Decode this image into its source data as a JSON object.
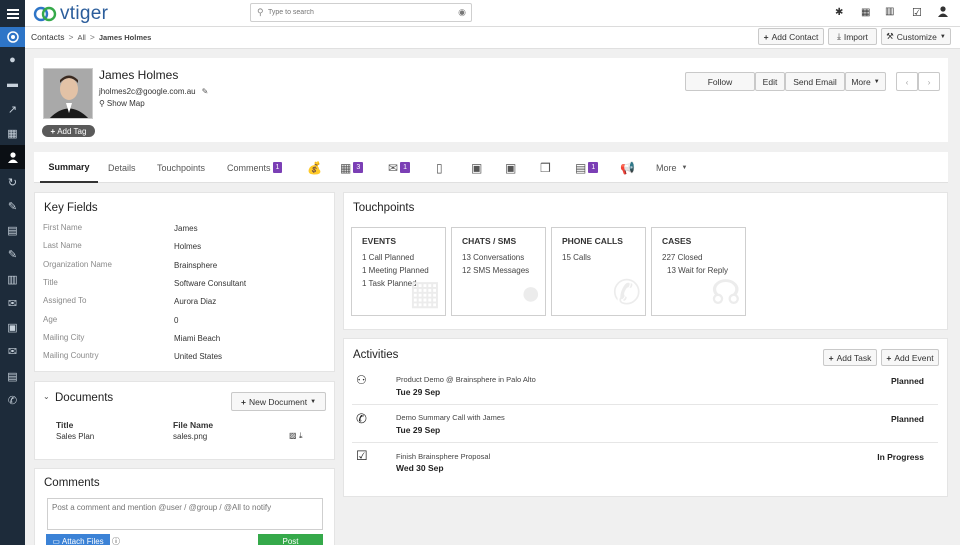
{
  "app": {
    "name": "vtiger"
  },
  "search": {
    "placeholder": "Type to search"
  },
  "breadcrumb": {
    "module": "Contacts",
    "filter": "All",
    "record": "James Holmes"
  },
  "header_actions": {
    "add": "Add Contact",
    "import": "Import",
    "customize": "Customize"
  },
  "contact": {
    "name": "James Holmes",
    "email": "jholmes2c@google.com.au",
    "show_map": "Show Map",
    "add_tag": "Add Tag"
  },
  "record_actions": {
    "follow": "Follow",
    "edit": "Edit",
    "send_email": "Send Email",
    "more": "More"
  },
  "tabs": [
    {
      "label": "Summary"
    },
    {
      "label": "Details"
    },
    {
      "label": "Touchpoints"
    },
    {
      "label": "Comments",
      "badge": "1"
    }
  ],
  "icon_tabs": [
    {
      "icon": "money-bag-icon",
      "badge": ""
    },
    {
      "icon": "calendar-icon",
      "badge": "3"
    },
    {
      "icon": "email-icon",
      "badge": "1"
    },
    {
      "icon": "contact-card-icon",
      "badge": ""
    },
    {
      "icon": "quote-icon",
      "badge": ""
    },
    {
      "icon": "sales-order-icon",
      "badge": ""
    },
    {
      "icon": "product-box-icon",
      "badge": ""
    },
    {
      "icon": "document-icon",
      "badge": "1"
    },
    {
      "icon": "campaign-megaphone-icon",
      "badge": ""
    }
  ],
  "tabs_more": "More",
  "key_fields": {
    "title": "Key Fields",
    "rows": [
      {
        "label": "First Name",
        "value": "James"
      },
      {
        "label": "Last Name",
        "value": "Holmes"
      },
      {
        "label": "Organization Name",
        "value": "Brainsphere"
      },
      {
        "label": "Title",
        "value": "Software Consultant"
      },
      {
        "label": "Assigned To",
        "value": "Aurora Diaz"
      },
      {
        "label": "Age",
        "value": "0"
      },
      {
        "label": "Mailing City",
        "value": "Miami Beach"
      },
      {
        "label": "Mailing Country",
        "value": "United States"
      }
    ]
  },
  "documents": {
    "title": "Documents",
    "new_button": "New Document",
    "col_title": "Title",
    "col_file": "File Name",
    "row": {
      "title": "Sales Plan",
      "file": "sales.png"
    }
  },
  "comments": {
    "title": "Comments",
    "placeholder": "Post a comment and mention @user / @group / @All to notify",
    "attach": "Attach Files",
    "post": "Post"
  },
  "touchpoints": {
    "title": "Touchpoints",
    "boxes": [
      {
        "title": "EVENTS",
        "lines": [
          "1 Call Planned",
          "1 Meeting Planned",
          "1 Task Planned"
        ]
      },
      {
        "title": "CHATS / SMS",
        "lines": [
          "13  Conversations",
          "12  SMS Messages"
        ]
      },
      {
        "title": "PHONE CALLS",
        "lines": [
          "15  Calls"
        ]
      },
      {
        "title": "CASES",
        "lines": [
          "227  Closed",
          "13  Wait for Reply"
        ]
      }
    ]
  },
  "activities": {
    "title": "Activities",
    "add_task": "Add Task",
    "add_event": "Add Event",
    "items": [
      {
        "icon": "meeting-icon",
        "subject": "Product Demo @ Brainsphere in Palo Alto",
        "date": "Tue 29 Sep",
        "status": "Planned"
      },
      {
        "icon": "phone-icon",
        "subject": "Demo Summary Call with James",
        "date": "Tue 29 Sep",
        "status": "Planned"
      },
      {
        "icon": "checkbox-icon",
        "subject": "Finish Brainsphere Proposal",
        "date": "Wed 30 Sep",
        "status": "In Progress"
      }
    ]
  },
  "colors": {
    "rail": "#1d2b3a",
    "accent_purple": "#7b3fb5",
    "post_green": "#35a94a",
    "attach_blue": "#3b82d6"
  }
}
